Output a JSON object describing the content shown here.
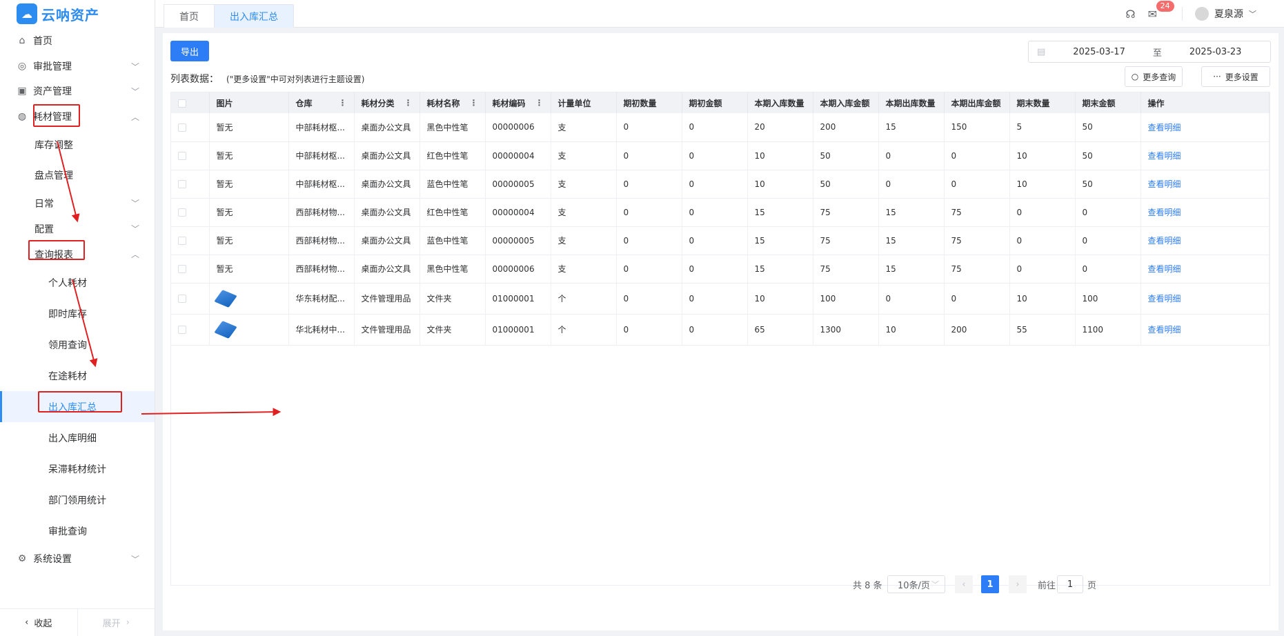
{
  "app": {
    "logo_text": "云呐资产"
  },
  "tabs": [
    {
      "label": "首页"
    },
    {
      "label": "出入库汇总"
    }
  ],
  "topbar": {
    "message_badge": "24",
    "user_name": "夏泉源"
  },
  "sidebar": {
    "items": [
      {
        "label": "首页",
        "icon": "home-icon"
      },
      {
        "label": "审批管理",
        "icon": "eye-icon"
      },
      {
        "label": "资产管理",
        "icon": "asset-icon"
      },
      {
        "label": "耗材管理",
        "icon": "consumable-icon"
      },
      {
        "label": "库存调整"
      },
      {
        "label": "盘点管理"
      },
      {
        "label": "日常"
      },
      {
        "label": "配置"
      },
      {
        "label": "查询报表"
      },
      {
        "label": "个人耗材"
      },
      {
        "label": "即时库存"
      },
      {
        "label": "领用查询"
      },
      {
        "label": "在途耗材"
      },
      {
        "label": "出入库汇总"
      },
      {
        "label": "出入库明细"
      },
      {
        "label": "呆滞耗材统计"
      },
      {
        "label": "部门领用统计"
      },
      {
        "label": "审批查询"
      },
      {
        "label": "系统设置",
        "icon": "gear-icon"
      }
    ],
    "collapse_label": "收起",
    "expand_label": "展开"
  },
  "toolbar": {
    "export_label": "导出",
    "date_start": "2025-03-17",
    "date_sep": "至",
    "date_end": "2025-03-23",
    "list_title": "列表数据：",
    "list_hint": "(\"更多设置\"中可对列表进行主题设置)",
    "more_query_label": "更多查询",
    "more_settings_label": "更多设置"
  },
  "table": {
    "columns": [
      "图片",
      "仓库",
      "耗材分类",
      "耗材名称",
      "耗材编码",
      "计量单位",
      "期初数量",
      "期初金额",
      "本期入库数量",
      "本期入库金额",
      "本期出库数量",
      "本期出库金额",
      "期末数量",
      "期末金额",
      "操作"
    ],
    "rows": [
      [
        "暂无",
        "中部耗材枢...",
        "桌面办公文具",
        "黑色中性笔",
        "00000006",
        "支",
        "0",
        "0",
        "20",
        "200",
        "15",
        "150",
        "5",
        "50",
        "查看明细"
      ],
      [
        "暂无",
        "中部耗材枢...",
        "桌面办公文具",
        "红色中性笔",
        "00000004",
        "支",
        "0",
        "0",
        "10",
        "50",
        "0",
        "0",
        "10",
        "50",
        "查看明细"
      ],
      [
        "暂无",
        "中部耗材枢...",
        "桌面办公文具",
        "蓝色中性笔",
        "00000005",
        "支",
        "0",
        "0",
        "10",
        "50",
        "0",
        "0",
        "10",
        "50",
        "查看明细"
      ],
      [
        "暂无",
        "西部耗材物...",
        "桌面办公文具",
        "红色中性笔",
        "00000004",
        "支",
        "0",
        "0",
        "15",
        "75",
        "15",
        "75",
        "0",
        "0",
        "查看明细"
      ],
      [
        "暂无",
        "西部耗材物...",
        "桌面办公文具",
        "蓝色中性笔",
        "00000005",
        "支",
        "0",
        "0",
        "15",
        "75",
        "15",
        "75",
        "0",
        "0",
        "查看明细"
      ],
      [
        "暂无",
        "西部耗材物...",
        "桌面办公文具",
        "黑色中性笔",
        "00000006",
        "支",
        "0",
        "0",
        "15",
        "75",
        "15",
        "75",
        "0",
        "0",
        "查看明细"
      ],
      [
        "",
        "华东耗材配...",
        "文件管理用品",
        "文件夹",
        "01000001",
        "个",
        "0",
        "0",
        "10",
        "100",
        "0",
        "0",
        "10",
        "100",
        "查看明细"
      ],
      [
        "",
        "华北耗材中...",
        "文件管理用品",
        "文件夹",
        "01000001",
        "个",
        "0",
        "0",
        "65",
        "1300",
        "10",
        "200",
        "55",
        "1100",
        "查看明细"
      ]
    ]
  },
  "pagination": {
    "total": "共 8 条",
    "page_size": "10条/页",
    "current_page": "1",
    "goto_label": "前往",
    "goto_value": "1",
    "page_suffix": "页"
  },
  "colors": {
    "accent": "#2d7df6",
    "annotation": "#e02020"
  }
}
